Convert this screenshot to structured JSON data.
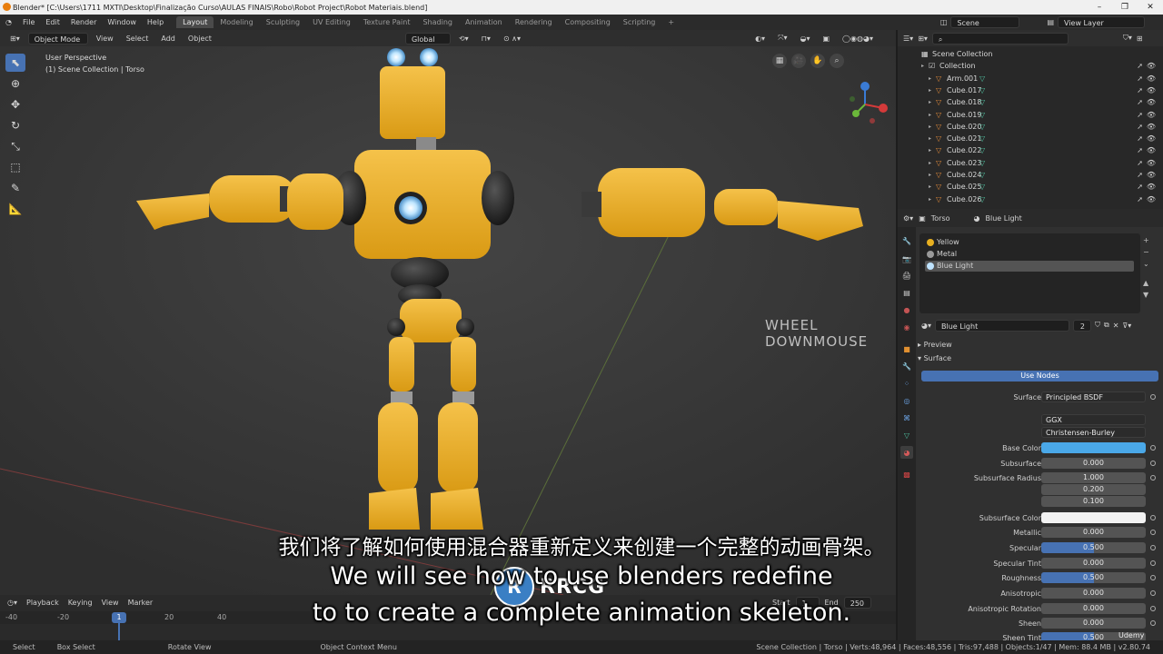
{
  "window": {
    "title": "Blender* [C:\\Users\\1711 MXTI\\Desktop\\Finalização Curso\\AULAS FINAIS\\Robo\\Robot Project\\Robot Materiais.blend]"
  },
  "menu": {
    "items": [
      "File",
      "Edit",
      "Render",
      "Window",
      "Help"
    ]
  },
  "workspaces": [
    "Layout",
    "Modeling",
    "Sculpting",
    "UV Editing",
    "Texture Paint",
    "Shading",
    "Animation",
    "Rendering",
    "Compositing",
    "Scripting"
  ],
  "active_workspace": "Layout",
  "scene": {
    "name": "Scene",
    "view_layer": "View Layer"
  },
  "viewport": {
    "mode": "Object Mode",
    "menus": [
      "View",
      "Select",
      "Add",
      "Object"
    ],
    "orientation": "Global",
    "perspective": "User Perspective",
    "collection_info": "(1) Scene Collection | Torso",
    "overlay_text": "WHEEL DOWNMOUSE"
  },
  "outliner": {
    "root": "Scene Collection",
    "collection": "Collection",
    "objects": [
      "Arm.001",
      "Cube.017",
      "Cube.018",
      "Cube.019",
      "Cube.020",
      "Cube.021",
      "Cube.022",
      "Cube.023",
      "Cube.024",
      "Cube.025",
      "Cube.026"
    ]
  },
  "properties": {
    "object": "Torso",
    "material": "Blue Light",
    "slots": [
      {
        "name": "Yellow",
        "color": "#e8b020"
      },
      {
        "name": "Metal",
        "color": "#9a9a9a"
      },
      {
        "name": "Blue Light",
        "color": "#bfe3ff"
      }
    ],
    "active_slot": "Blue Light",
    "material_field": "Blue Light",
    "user_count": "2",
    "panel_preview": "Preview",
    "panel_surface": "Surface",
    "use_nodes": "Use Nodes",
    "surface_label": "Surface",
    "surface_value": "Principled BSDF",
    "distribution": "GGX",
    "subsurface_method": "Christensen-Burley",
    "base_color_label": "Base Color",
    "base_color": "#4aa8e8",
    "subsurface_label": "Subsurface",
    "subsurface": "0.000",
    "subsurface_radius_label": "Subsurface Radius",
    "subsurface_radius": [
      "1.000",
      "0.200",
      "0.100"
    ],
    "subsurface_color_label": "Subsurface Color",
    "subsurface_color": "#f2f2f2",
    "metallic_label": "Metallic",
    "metallic": "0.000",
    "specular_label": "Specular",
    "specular": "0.500",
    "specular_tint_label": "Specular Tint",
    "specular_tint": "0.000",
    "roughness_label": "Roughness",
    "roughness": "0.500",
    "anisotropic_label": "Anisotropic",
    "anisotropic": "0.000",
    "anisotropic_rotation_label": "Anisotropic Rotation",
    "anisotropic_rotation": "0.000",
    "sheen_label": "Sheen",
    "sheen": "0.000",
    "sheen_tint_label": "Sheen Tint",
    "sheen_tint": "0.500"
  },
  "timeline": {
    "menus": [
      "Playback",
      "Keying",
      "View",
      "Marker"
    ],
    "ticks": [
      "-40",
      "-20",
      "20",
      "40"
    ],
    "current_frame": "1",
    "start_label": "Start",
    "start": "1",
    "end_label": "End",
    "end": "250"
  },
  "status": {
    "select": "Select",
    "box_select": "Box Select",
    "rotate_view": "Rotate View",
    "context_menu": "Object Context Menu",
    "stats": "Scene Collection | Torso | Verts:48,964 | Faces:48,556 | Tris:97,488 | Objects:1/47 | Mem: 88.4 MB | v2.80.74"
  },
  "subtitles": {
    "cn": "我们将了解如何使用混合器重新定义来创建一个完整的动画骨架。",
    "en1": "We will see how to use blenders redefine",
    "en2": "to to create a complete animation skeleton."
  },
  "watermark": {
    "mark": "R",
    "text": "RRCG"
  },
  "udemy": "Udemy"
}
